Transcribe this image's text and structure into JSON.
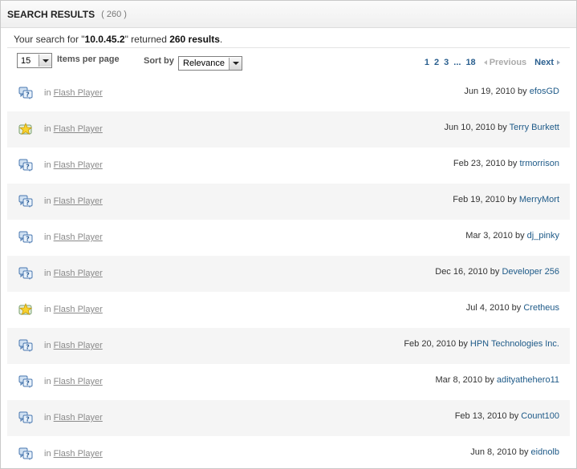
{
  "header": {
    "title": "SEARCH RESULTS",
    "count": "( 260 )"
  },
  "summary": {
    "prefix": "Your search for \"",
    "query": "10.0.45.2",
    "middle": "\" returned ",
    "count": "260 results",
    "suffix": "."
  },
  "controls": {
    "per_page_value": "15",
    "per_page_label": "Items per page",
    "sort_label": "Sort by",
    "sort_value": "Relevance"
  },
  "pager": {
    "pages": [
      "1",
      "2",
      "3"
    ],
    "ellipsis": "...",
    "last": "18",
    "prev": "Previous",
    "next": "Next"
  },
  "results": [
    {
      "icon": "question-icon",
      "in": "in",
      "place": "Flash Player",
      "date": "Jun 19, 2010",
      "by": "by",
      "author": "efosGD"
    },
    {
      "icon": "star-icon",
      "in": "in",
      "place": "Flash Player",
      "date": "Jun 10, 2010",
      "by": "by",
      "author": "Terry Burkett"
    },
    {
      "icon": "question-icon",
      "in": "in",
      "place": "Flash Player",
      "date": "Feb 23, 2010",
      "by": "by",
      "author": "trmorrison"
    },
    {
      "icon": "question-icon",
      "in": "in",
      "place": "Flash Player",
      "date": "Feb 19, 2010",
      "by": "by",
      "author": "MerryMort"
    },
    {
      "icon": "question-icon",
      "in": "in",
      "place": "Flash Player",
      "date": "Mar 3, 2010",
      "by": "by",
      "author": "dj_pinky"
    },
    {
      "icon": "question-icon",
      "in": "in",
      "place": "Flash Player",
      "date": "Dec 16, 2010",
      "by": "by",
      "author": "Developer 256"
    },
    {
      "icon": "star-icon",
      "in": "in",
      "place": "Flash Player",
      "date": "Jul 4, 2010",
      "by": "by",
      "author": "Cretheus"
    },
    {
      "icon": "question-icon",
      "in": "in",
      "place": "Flash Player",
      "date": "Feb 20, 2010",
      "by": "by",
      "author": "HPN Technologies Inc."
    },
    {
      "icon": "question-icon",
      "in": "in",
      "place": "Flash Player",
      "date": "Mar 8, 2010",
      "by": "by",
      "author": "adityathehero11"
    },
    {
      "icon": "question-icon",
      "in": "in",
      "place": "Flash Player",
      "date": "Feb 13, 2010",
      "by": "by",
      "author": "Count100"
    },
    {
      "icon": "question-icon",
      "in": "in",
      "place": "Flash Player",
      "date": "Jun 8, 2010",
      "by": "by",
      "author": "eidnolb"
    }
  ]
}
